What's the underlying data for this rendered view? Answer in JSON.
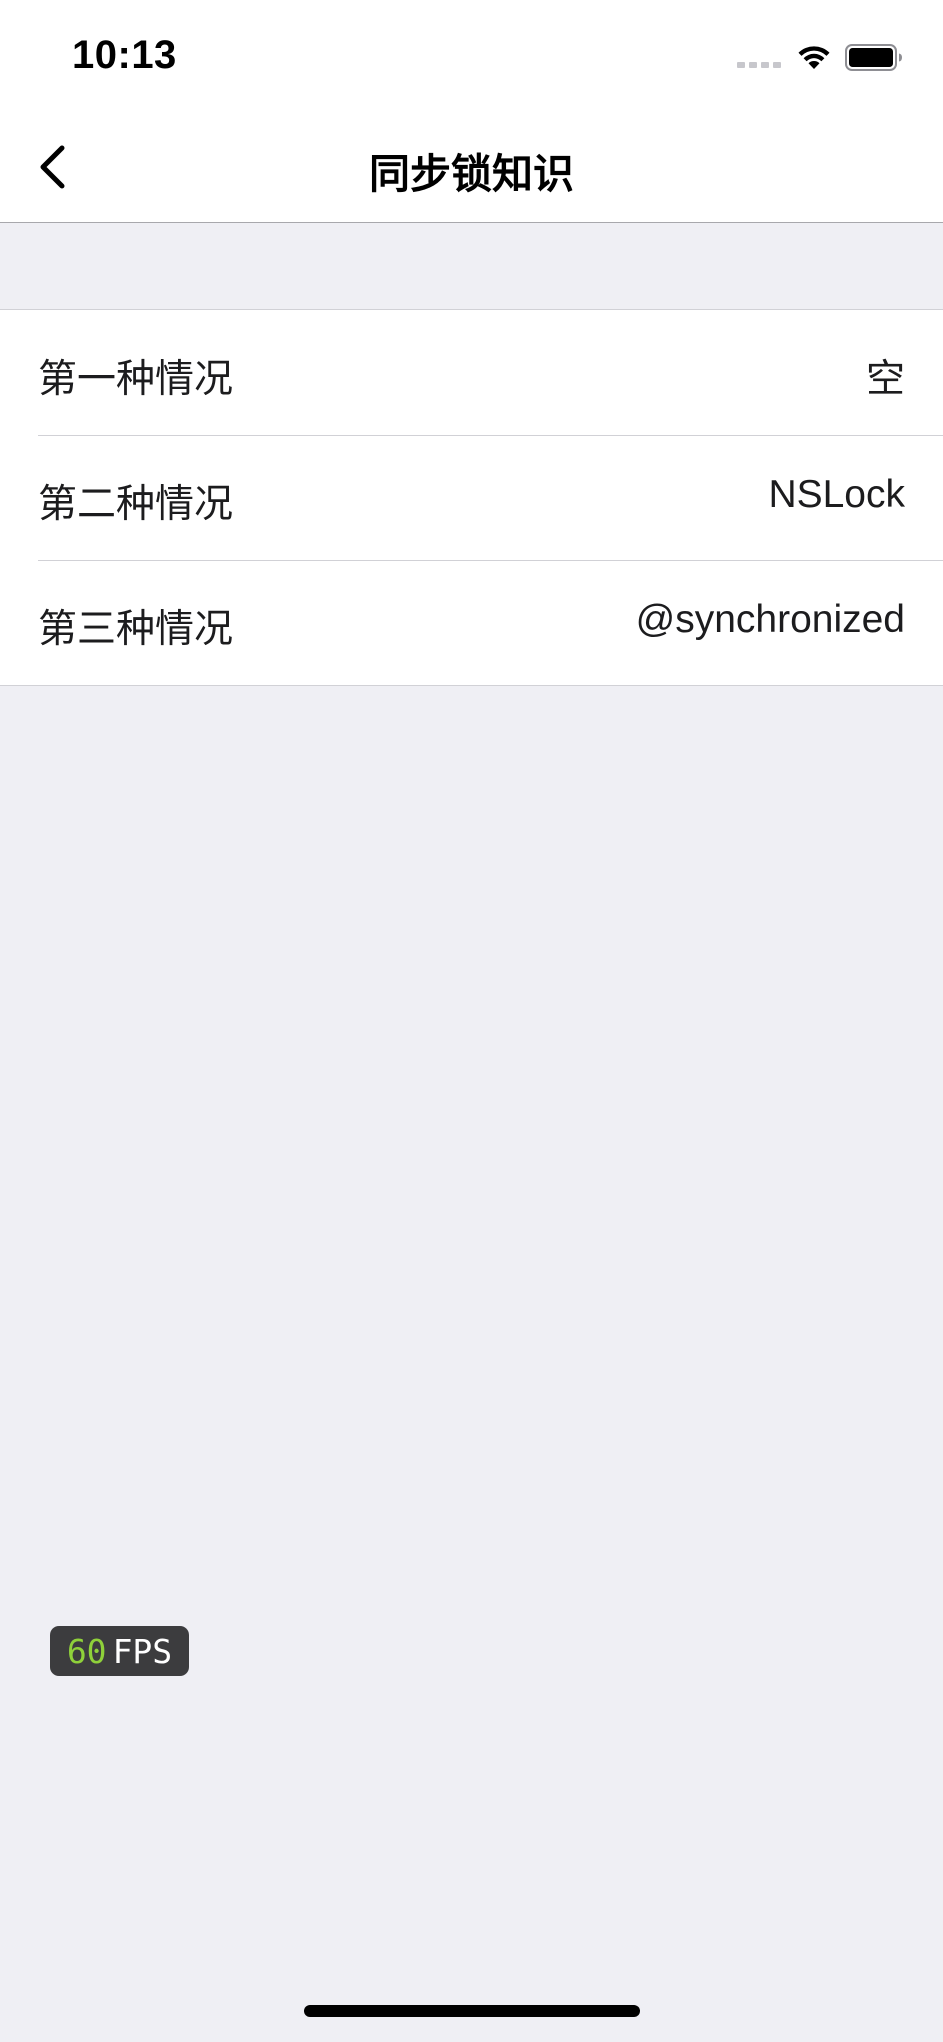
{
  "status_bar": {
    "time": "10:13",
    "icons": [
      "cellular-signal-icon",
      "wifi-icon",
      "battery-icon"
    ]
  },
  "nav": {
    "title": "同步锁知识",
    "back_icon": "chevron-left-icon"
  },
  "rows": [
    {
      "title": "第一种情况",
      "detail": "空"
    },
    {
      "title": "第二种情况",
      "detail": "NSLock"
    },
    {
      "title": "第三种情况",
      "detail": "@synchronized"
    }
  ],
  "fps": {
    "value": "60",
    "label": "FPS"
  },
  "colors": {
    "background": "#efeff4",
    "cell": "#ffffff",
    "separator": "#d1d1d6",
    "fps_value": "#8fd13a",
    "fps_badge": "#3c3c3e"
  }
}
